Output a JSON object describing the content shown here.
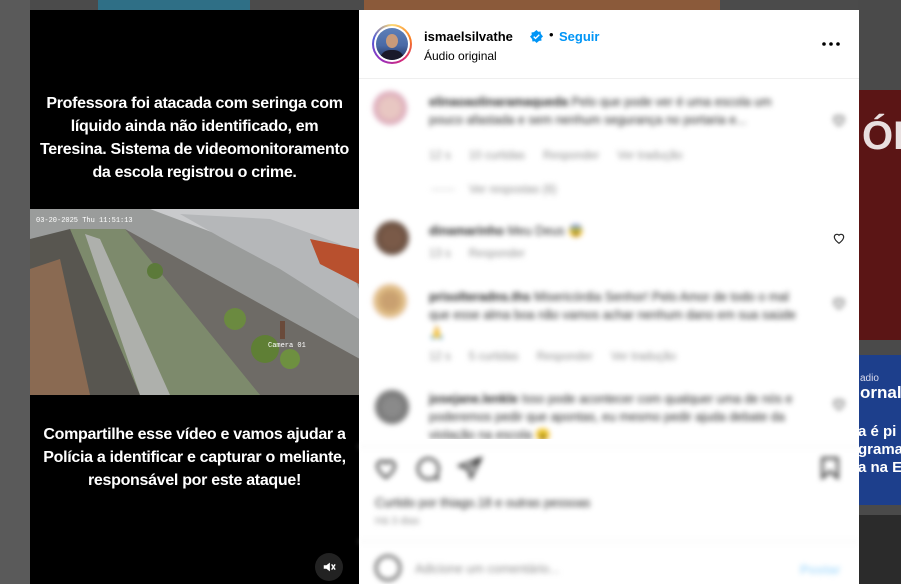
{
  "background": {
    "right_tile_letters": "ÓRI",
    "right_tile2_small": "adio",
    "right_tile2_big": "ornal",
    "right_tile2_lines": [
      "a é pi",
      "grama",
      "a na E"
    ]
  },
  "video": {
    "top_text": "Professora foi atacada com seringa com líquido ainda não identificado, em Teresina. Sistema de videomonitoramento da escola registrou o crime.",
    "bottom_text": "Compartilhe esse vídeo e vamos ajudar a Polícia a identificar e capturar o meliante, responsável por este ataque!",
    "cctv_timestamp": "03-20-2025 Thu 11:51:13",
    "cctv_camera": "Camera 01",
    "mute_icon": "speaker-muted-icon"
  },
  "post": {
    "username": "ismaelsilvathe",
    "follow_label": "Seguir",
    "separator": "•",
    "audio_label": "Áudio original"
  },
  "comments": [
    {
      "user": "elinaoaolinaramaqueda",
      "text": "Pelo que pode ver é uma escola um pouco afastada e sem nenhum segurança no portaria e...",
      "meta": [
        "12 s",
        "10 curtidas",
        "Responder",
        "Ver tradução"
      ],
      "replies": "Ver respostas (6)"
    },
    {
      "user": "dinamarinho",
      "text": "Meu Deus 😨",
      "meta": [
        "13 s",
        "Responder"
      ]
    },
    {
      "user": "prisolteradns.ths",
      "text": "Misericórdia Senhor! Pelo Amor de todo o mal que esse alma boa não vamos achar nenhum dano em sua saúde 🙏",
      "meta": [
        "12 s",
        "5 curtidas",
        "Responder",
        "Ver tradução"
      ]
    },
    {
      "user": "josejane.lenkle",
      "text": "Isso pode acontecer com qualquer uma de nós e poderemos pedir que apontas, eu mesmo pedir ajuda debate da violação na escola 😮",
      "meta": []
    }
  ],
  "likes_text": "Curtido por thiago.18 e outras pessoas",
  "time_text": "Há 3 dias",
  "add_comment_placeholder": "Adicione um comentário...",
  "post_button": "Postar"
}
